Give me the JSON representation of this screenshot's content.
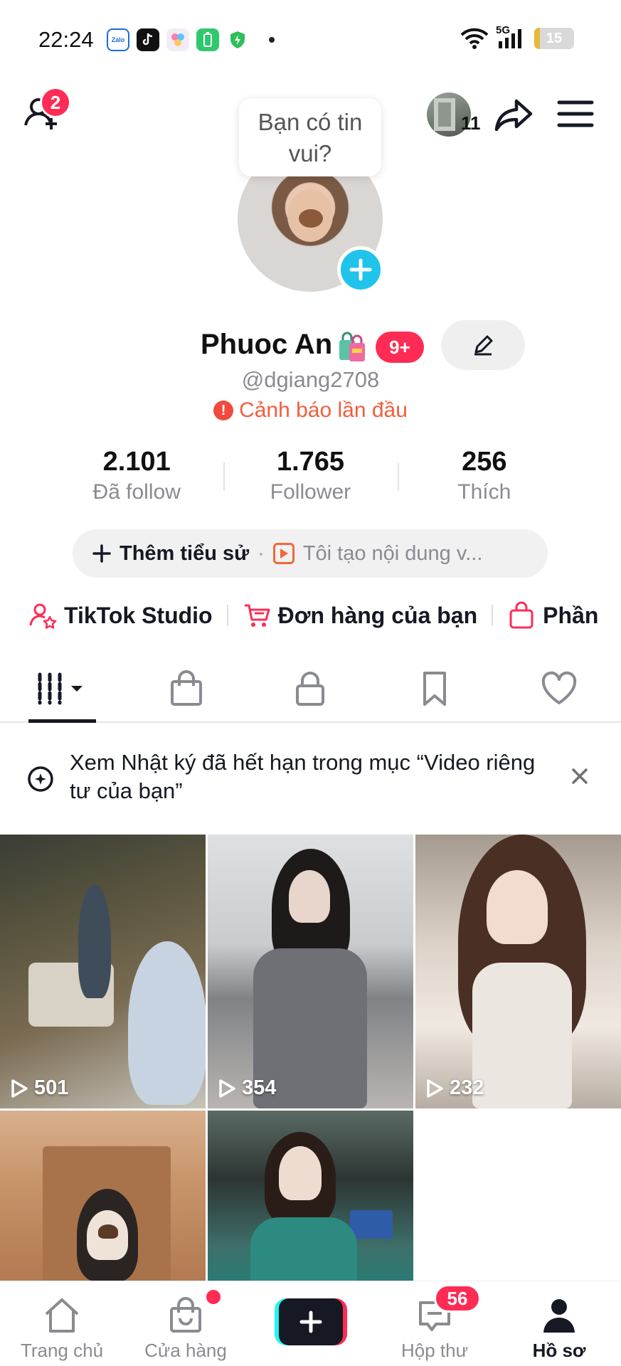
{
  "status_bar": {
    "time": "22:24",
    "network": "5G",
    "battery": "15",
    "battery_level": 0.15
  },
  "header": {
    "friend_request_count": "2",
    "story_count": "11",
    "speech_bubble": "Bạn có tin vui?"
  },
  "profile": {
    "display_name": "Phuoc An",
    "name_badge": "9+",
    "username": "@dgiang2708",
    "warning": "Cảnh báo lần đầu",
    "stats": [
      {
        "value": "2.101",
        "label": "Đã follow"
      },
      {
        "value": "1.765",
        "label": "Follower"
      },
      {
        "value": "256",
        "label": "Thích"
      }
    ],
    "bio_add": "Thêm tiểu sử",
    "bio_separator": "·",
    "bio_prompt": "Tôi tạo nội dung v..."
  },
  "shortcuts": [
    {
      "label": "TikTok Studio",
      "icon": "person-star-icon"
    },
    {
      "label": "Đơn hàng của bạn",
      "icon": "cart-icon"
    },
    {
      "label": "Phần",
      "icon": "shopping-bag-icon"
    }
  ],
  "tabs": [
    {
      "name": "videos-grid",
      "icon": "grid-bars-icon",
      "active": true
    },
    {
      "name": "shop",
      "icon": "bag-icon",
      "active": false
    },
    {
      "name": "private",
      "icon": "lock-icon",
      "active": false
    },
    {
      "name": "saved",
      "icon": "bookmark-icon",
      "active": false
    },
    {
      "name": "liked",
      "icon": "heart-icon",
      "active": false
    }
  ],
  "notice": {
    "text": "Xem Nhật ký đã hết hạn trong mục “Video riêng tư của bạn”"
  },
  "videos": [
    {
      "views": "501"
    },
    {
      "views": "354"
    },
    {
      "views": "232"
    },
    {
      "views": ""
    },
    {
      "views": ""
    }
  ],
  "bottom_nav": {
    "home": "Trang chủ",
    "shop": "Cửa hàng",
    "inbox": "Hộp thư",
    "inbox_badge": "56",
    "profile": "Hồ sơ"
  },
  "colors": {
    "accent": "#fe2c55",
    "cyan": "#25f4ee",
    "text_primary": "#161823",
    "text_secondary": "#8a8b91",
    "warning": "#f25d3c"
  }
}
